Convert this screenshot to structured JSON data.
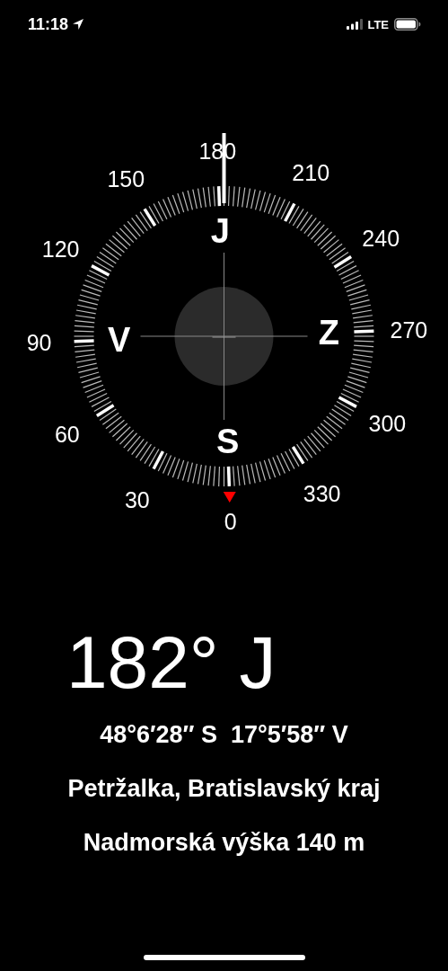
{
  "status_bar": {
    "time": "11:18",
    "network": "LTE"
  },
  "compass": {
    "degree_labels": [
      "0",
      "30",
      "60",
      "90",
      "120",
      "150",
      "180",
      "210",
      "240",
      "270",
      "300",
      "330"
    ],
    "cardinals": [
      "S",
      "V",
      "J",
      "Z"
    ]
  },
  "heading": "182° J",
  "coordinates": "48°6′28″ S  17°5′58″ V",
  "location": "Petržalka, Bratislavský kraj",
  "altitude": "Nadmorská výška 140 m"
}
